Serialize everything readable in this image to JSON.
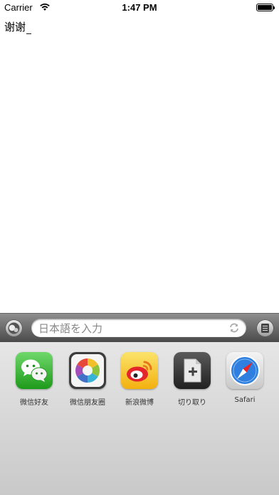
{
  "status_bar": {
    "carrier": "Carrier",
    "time": "1:47 PM"
  },
  "document": {
    "text": "谢谢"
  },
  "input_bar": {
    "placeholder": "日本語を入力",
    "left_button_icon": "shape-icon",
    "refresh_icon": "refresh-icon",
    "right_button_icon": "notebook-icon"
  },
  "share_targets": [
    {
      "label": "微信好友",
      "icon": "wechat-icon",
      "color": "#2fb52c"
    },
    {
      "label": "微信朋友圈",
      "icon": "moments-icon",
      "color": "#f2f2f2"
    },
    {
      "label": "新浪微博",
      "icon": "weibo-icon",
      "color": "#f7c21b"
    },
    {
      "label": "切り取り",
      "icon": "clip-icon",
      "color": "#3a3a3a"
    },
    {
      "label": "Safari",
      "icon": "safari-icon",
      "color": "#2e7fe0"
    }
  ]
}
